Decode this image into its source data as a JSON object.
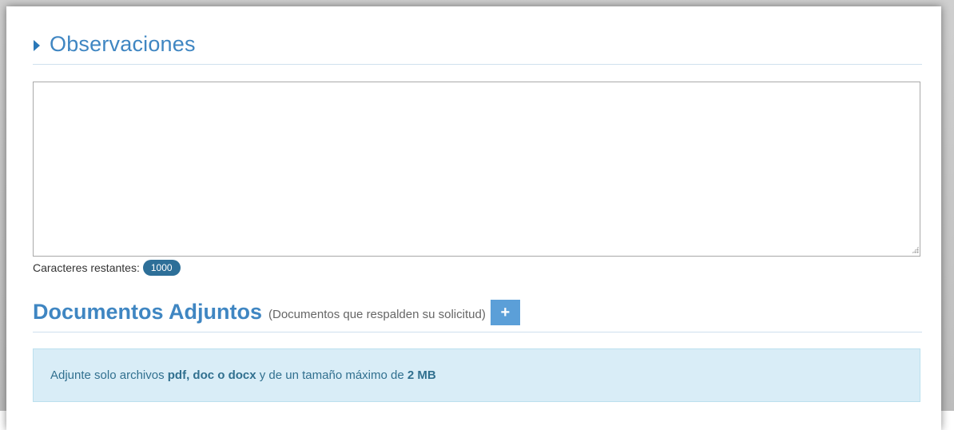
{
  "observaciones": {
    "title": "Observaciones",
    "textarea_value": "",
    "counter_label": "Caracteres restantes:",
    "counter_value": "1000"
  },
  "documentos": {
    "title": "Documentos Adjuntos",
    "subtitle": "(Documentos que respalden su solicitud)",
    "add_button_label": "+",
    "info": {
      "prefix": "Adjunte solo archivos ",
      "formats": "pdf, doc o docx",
      "middle": " y de un tamaño máximo de ",
      "max_size": "2 MB"
    }
  },
  "colors": {
    "accent": "#3f86c2",
    "badge": "#2d6f98",
    "button": "#5b9fd8",
    "alert_bg": "#d9edf7",
    "alert_text": "#31708f"
  },
  "icons": {
    "section_marker": "caret-right-icon",
    "resize": "resize-grip-icon"
  }
}
